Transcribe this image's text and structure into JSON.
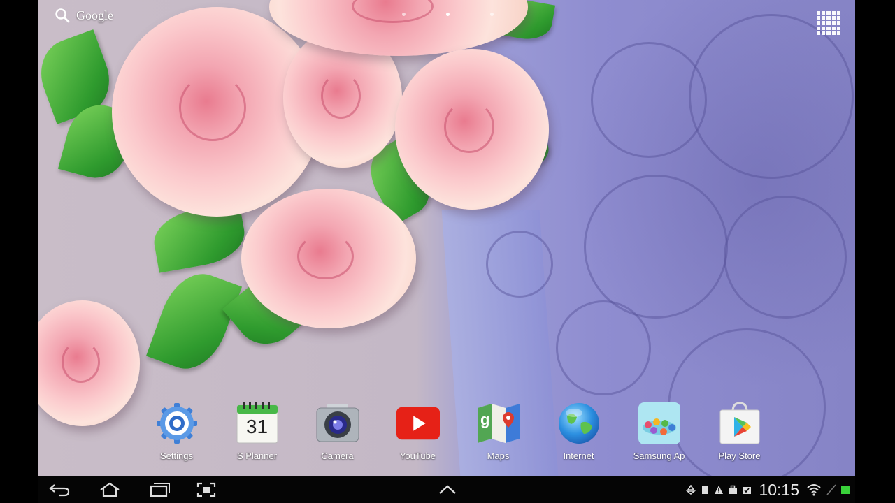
{
  "top_bar": {
    "search_label": "Google"
  },
  "dock_apps": [
    {
      "name": "settings",
      "label": "Settings"
    },
    {
      "name": "s-planner",
      "label": "S Planner",
      "day": "31"
    },
    {
      "name": "camera",
      "label": "Camera"
    },
    {
      "name": "youtube",
      "label": "YouTube"
    },
    {
      "name": "maps",
      "label": "Maps"
    },
    {
      "name": "internet",
      "label": "Internet"
    },
    {
      "name": "samsung-apps",
      "label": "Samsung Ap"
    },
    {
      "name": "play-store",
      "label": "Play Store"
    }
  ],
  "status_bar": {
    "time": "10:15"
  },
  "colors": {
    "youtube_red": "#e62117",
    "battery_green": "#39d23a"
  },
  "icons": [
    "search-icon",
    "apps-grid-icon",
    "back-icon",
    "home-icon",
    "recents-icon",
    "screenshot-icon",
    "up-chevron-icon",
    "recycle-icon",
    "sd-card-icon",
    "warning-icon",
    "briefcase-icon",
    "task-check-icon",
    "wifi-icon",
    "battery-icon"
  ]
}
